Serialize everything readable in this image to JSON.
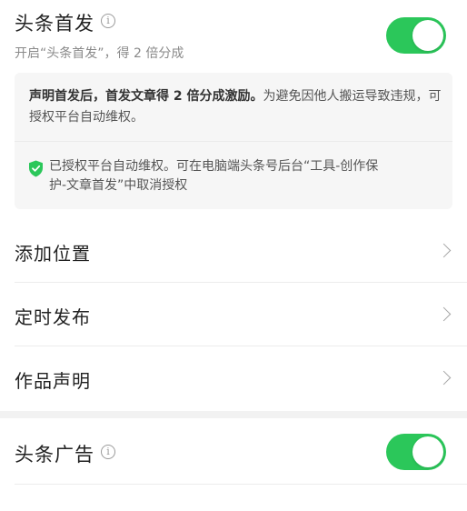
{
  "first_publish": {
    "title": "头条首发",
    "subtitle": "开启“头条首发”，得 2 倍分成",
    "toggle_on": true,
    "notice_bold": "声明首发后，首发文章得 2 倍分成激励。",
    "notice_rest": "为避免因他人搬运导致违规，可授权平台自动维权。",
    "auth_line1": "已授权平台自动维权。可在电脑端头条号后台“工具-创作保",
    "auth_line2": "护-文章首发”中取消授权"
  },
  "rows": [
    {
      "label": "添加位置"
    },
    {
      "label": "定时发布"
    },
    {
      "label": "作品声明"
    }
  ],
  "ads": {
    "title": "头条广告",
    "toggle_on": true
  },
  "colors": {
    "toggle_on": "#2bc75a",
    "shield": "#2bc75a"
  }
}
